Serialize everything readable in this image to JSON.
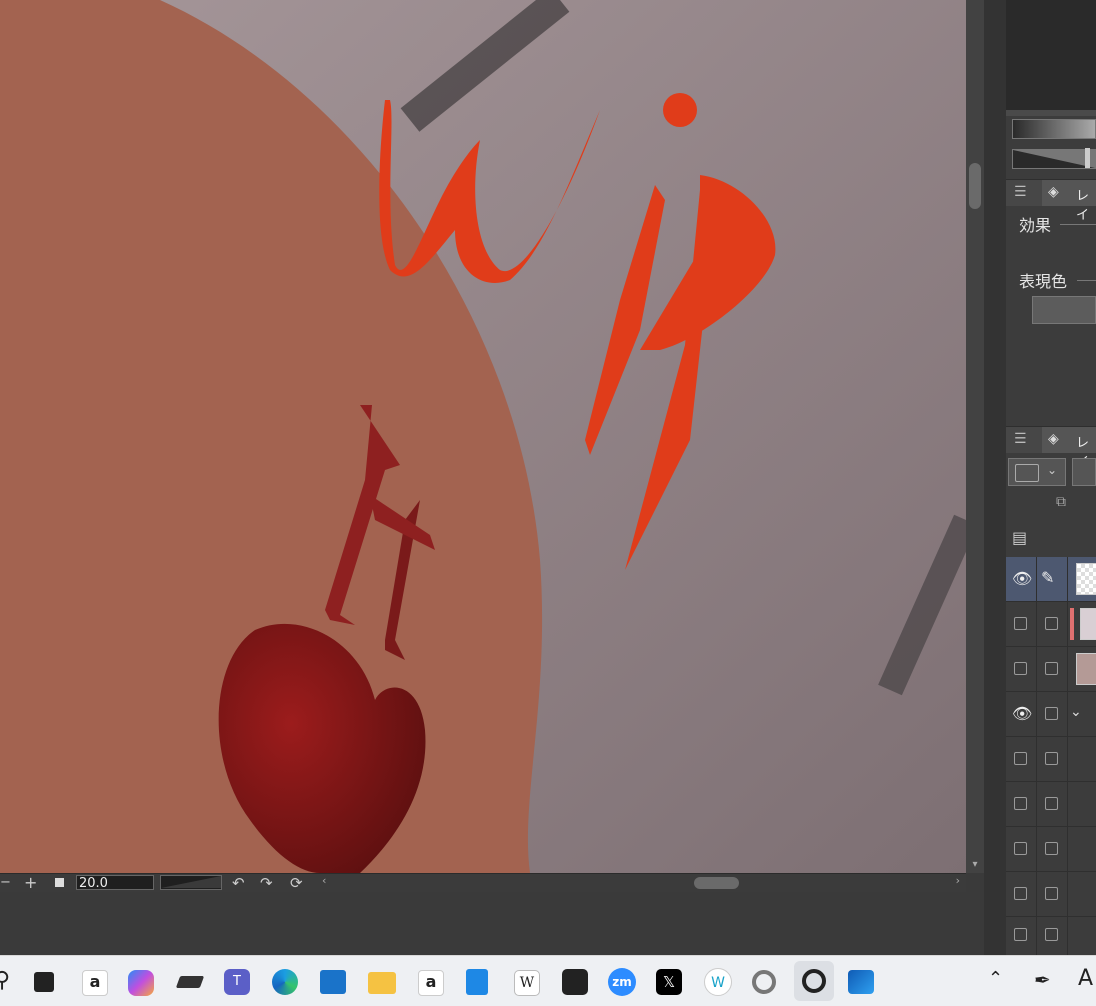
{
  "canvas": {
    "background_color": "#9a888b",
    "figure_color": "#a36350",
    "artwork_text": "wip"
  },
  "status_bar": {
    "zoom_value": "20.0",
    "minus_label": "−",
    "plus_label": "+"
  },
  "right_panel": {
    "tab_upper_label": "レイ",
    "effect_label": "効果",
    "expression_color_label": "表現色",
    "tab_layer_label": "レイ"
  },
  "taskbar": {
    "apps": [
      "search-icon",
      "task-view-icon",
      "amazon-icon",
      "copilot-icon",
      "eraser-app-icon",
      "teams-icon",
      "edge-icon",
      "store-icon",
      "file-explorer-icon",
      "amazon-icon",
      "notepad-icon",
      "wikipedia-icon",
      "toolbox-icon",
      "zoom-icon",
      "x-icon",
      "w-icon",
      "link-icon",
      "clip-studio-icon",
      "outlook-icon"
    ],
    "wikipedia_label": "W",
    "zoom_label": "zm",
    "x_label": "𝕏",
    "w_label": "W"
  },
  "colors": {
    "accent_red": "#e03c1a",
    "selection_blue": "#4d5870"
  }
}
